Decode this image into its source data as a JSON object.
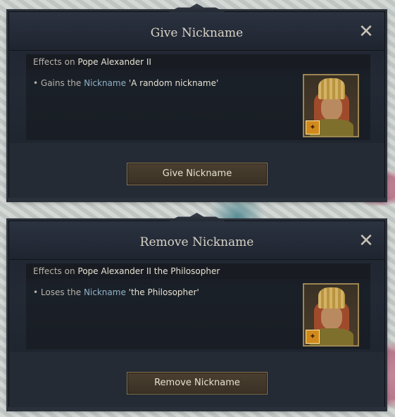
{
  "dialogs": [
    {
      "title": "Give Nickname",
      "effects_prefix": "Effects on",
      "target": "Pope Alexander II",
      "bullet": "•",
      "effect_verb": "Gains the",
      "effect_link": "Nickname",
      "effect_value": "'A random nickname'",
      "button_label": "Give Nickname",
      "close_glyph": "✕"
    },
    {
      "title": "Remove Nickname",
      "effects_prefix": "Effects on",
      "target": "Pope Alexander II the Philosopher",
      "bullet": "•",
      "effect_verb": "Loses the",
      "effect_link": "Nickname",
      "effect_value": "'the Philosopher'",
      "button_label": "Remove Nickname",
      "close_glyph": "✕"
    }
  ],
  "icons": {
    "close": "close-icon",
    "portrait": "portrait-icon",
    "badge": "trait-badge-icon"
  },
  "colors": {
    "link": "#8fb2c7",
    "button_border": "#8a7651",
    "dialog_bg": "#1f2530"
  }
}
